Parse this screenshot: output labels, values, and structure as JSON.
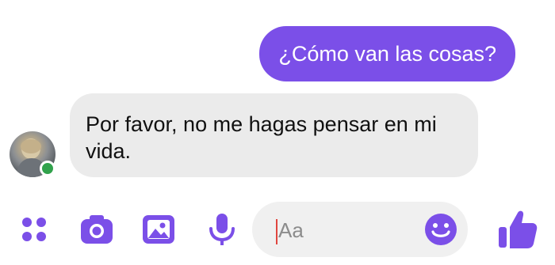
{
  "messages": {
    "outgoing_text": "¿Cómo van las cosas?",
    "incoming_text": "Por favor, no me hagas pensar en mi vida."
  },
  "composer": {
    "placeholder": "Aa",
    "tools": [
      "apps-icon",
      "camera-icon",
      "image-icon",
      "microphone-icon",
      "emoji-icon",
      "thumbs-up-icon"
    ]
  },
  "colors": {
    "accent": "#7b4fe8",
    "incoming_bubble": "#ebebeb",
    "presence": "#31a24c",
    "caret": "#e0463f"
  }
}
